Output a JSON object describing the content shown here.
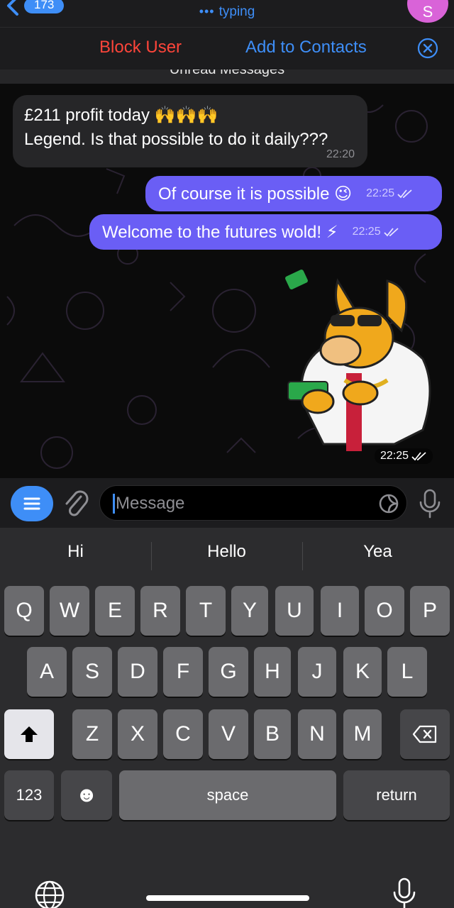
{
  "header": {
    "counter": "173",
    "typing_label": "typing",
    "avatar_initial": "S"
  },
  "action_bar": {
    "block_label": "Block User",
    "add_contacts_label": "Add to Contacts"
  },
  "unread_label": "Unread Messages",
  "messages": [
    {
      "direction": "in",
      "line1": "£211 profit today 🙌🙌🙌",
      "line2": "Legend. Is that possible to do it daily???",
      "time": "22:20"
    },
    {
      "direction": "out",
      "text": "Of course it is possible 😉",
      "time": "22:25",
      "status": "read"
    },
    {
      "direction": "out",
      "text": "Welcome to the futures wold! ⚡",
      "time": "22:25",
      "status": "read"
    },
    {
      "direction": "out",
      "type": "sticker",
      "time": "22:25",
      "status": "read"
    }
  ],
  "input": {
    "placeholder": "Message"
  },
  "keyboard": {
    "suggestions": [
      "Hi",
      "Hello",
      "Yea"
    ],
    "row1": [
      "Q",
      "W",
      "E",
      "R",
      "T",
      "Y",
      "U",
      "I",
      "O",
      "P"
    ],
    "row2": [
      "A",
      "S",
      "D",
      "F",
      "G",
      "H",
      "J",
      "K",
      "L"
    ],
    "row3": [
      "Z",
      "X",
      "C",
      "V",
      "B",
      "N",
      "M"
    ],
    "numbers_label": "123",
    "space_label": "space",
    "return_label": "return",
    "emoji_glyph": "☻"
  },
  "colors": {
    "accent": "#3e8ef7",
    "outgoing_bubble": "#6a5ef5",
    "destructive": "#ff453a",
    "avatar": "#d963d8"
  }
}
